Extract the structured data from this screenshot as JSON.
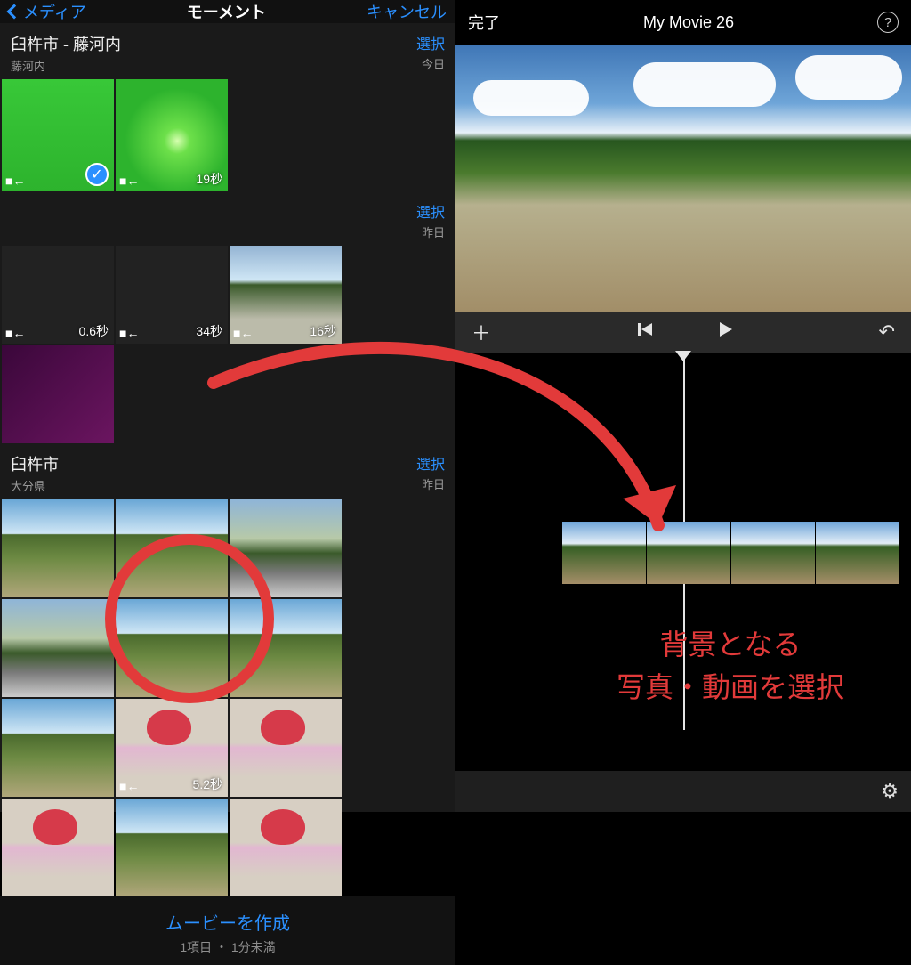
{
  "left": {
    "back": "メディア",
    "title": "モーメント",
    "cancel": "キャンセル",
    "sections": [
      {
        "title": "臼杵市 - 藤河内",
        "subtitle": "藤河内",
        "select": "選択",
        "select_sub": "今日",
        "thumbs": [
          {
            "kind": "green1",
            "video": true,
            "duration": "",
            "selected": true
          },
          {
            "kind": "green2",
            "video": true,
            "duration": "19秒",
            "selected": false
          }
        ]
      },
      {
        "title": "",
        "subtitle": "",
        "select": "選択",
        "select_sub": "昨日",
        "thumbs": [
          {
            "kind": "dark1",
            "video": true,
            "duration": "0.6秒"
          },
          {
            "kind": "dark2",
            "video": true,
            "duration": "34秒"
          },
          {
            "kind": "roadgrass",
            "video": true,
            "duration": "16秒"
          },
          {
            "kind": "dark4",
            "video": false,
            "duration": ""
          }
        ]
      },
      {
        "title": "臼杵市",
        "subtitle": "大分県",
        "select": "選択",
        "select_sub": "昨日",
        "thumbs": [
          {
            "kind": "land"
          },
          {
            "kind": "land"
          },
          {
            "kind": "road"
          },
          {
            "kind": "road"
          },
          {
            "kind": "land"
          },
          {
            "kind": "land"
          },
          {
            "kind": "land"
          },
          {
            "kind": "kid",
            "video": true,
            "duration": "5.2秒"
          },
          {
            "kind": "kid"
          },
          {
            "kind": "kid"
          },
          {
            "kind": "land"
          },
          {
            "kind": "kid"
          }
        ]
      }
    ],
    "footer": {
      "create": "ムービーを作成",
      "meta": "1項目 ・ 1分未満"
    }
  },
  "right": {
    "done": "完了",
    "title": "My Movie 26",
    "controls": {
      "add": "＋",
      "prev": "|◀",
      "play": "▶",
      "undo": "↶"
    },
    "gear": "⚙"
  },
  "annotation": {
    "line1": "背景となる",
    "line2": "写真・動画を選択"
  },
  "colors": {
    "accent_blue": "#2b90ff",
    "anno_red": "#e23a3a"
  }
}
